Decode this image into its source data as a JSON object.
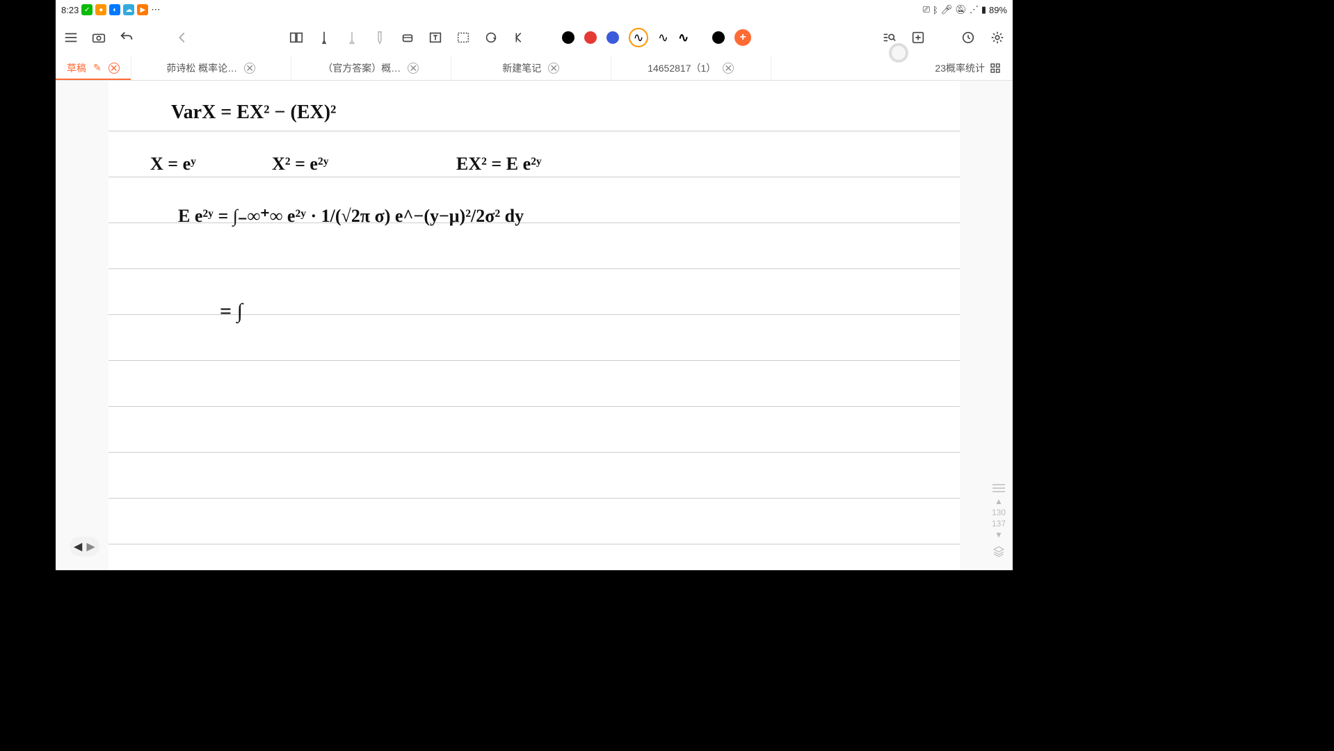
{
  "status": {
    "time": "8:23",
    "battery_text": "89%",
    "more": "⋯"
  },
  "tabs": [
    {
      "label": "草稿",
      "active": true,
      "editable": true
    },
    {
      "label": "茆诗松 概率论…"
    },
    {
      "label": "（官方答案）概…"
    },
    {
      "label": "新建笔记"
    },
    {
      "label": "14652817（1）"
    },
    {
      "label": "23概率统计",
      "last": true,
      "no_close": true
    }
  ],
  "side": {
    "page_from": "130",
    "page_to": "137"
  },
  "handwriting": {
    "l1": "VarX  =   EX² −  (EX)²",
    "l2a": "X = eʸ",
    "l2b": "X² = e²ʸ",
    "l2c": "EX² =  E e²ʸ",
    "l3": "E e²ʸ =   ∫₋∞⁺∞  e²ʸ ·  1/(√2π σ)  e^−(y−μ)²/2σ²  dy",
    "l4": "=    ∫"
  }
}
